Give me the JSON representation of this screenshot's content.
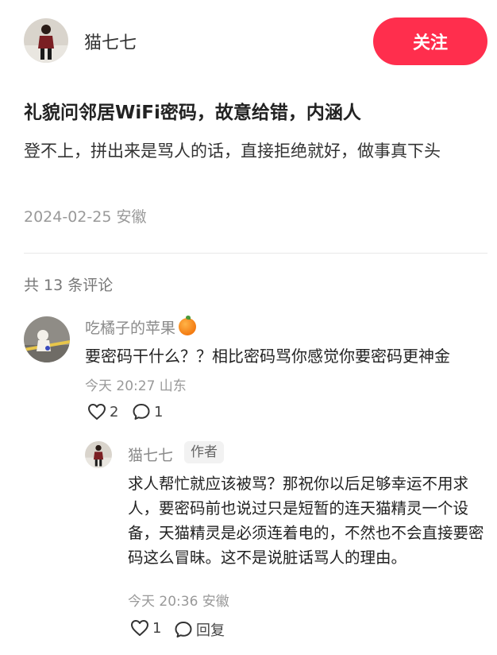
{
  "header": {
    "author_name": "猫七七",
    "follow_label": "关注",
    "accent_color": "#ff2e4d"
  },
  "post": {
    "title": "礼貌问邻居WiFi密码，故意给错，内涵人",
    "body": "登不上，拼出来是骂人的话，直接拒绝就好，做事真下头",
    "date_location": "2024-02-25 安徽"
  },
  "comments_header": {
    "count_text": "共 13 条评论"
  },
  "comments": [
    {
      "user": "吃橘子的苹果",
      "user_emoji": "orange-emoji",
      "text": "要密码干什么？？相比密码骂你感觉你要密码更神金",
      "meta": "今天 20:27 山东",
      "likes": "2",
      "replies": "1"
    }
  ],
  "reply": {
    "user": "猫七七",
    "tag": "作者",
    "text": "求人帮忙就应该被骂？那祝你以后足够幸运不用求人，要密码前也说过只是短暂的连天猫精灵一个设备，天猫精灵是必须连着电的，不然也不会直接要密码这么冒昧。这不是说脏话骂人的理由。",
    "meta": "今天 20:36 安徽",
    "likes": "1",
    "reply_label": "回复"
  }
}
